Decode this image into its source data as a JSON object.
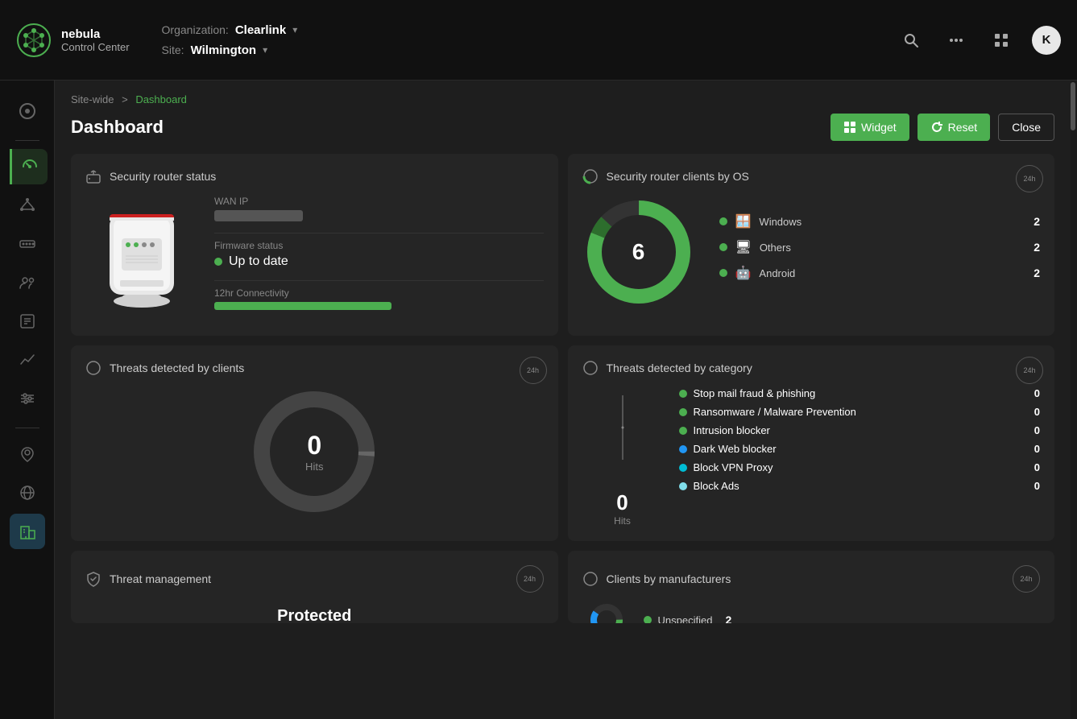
{
  "app": {
    "brand": "nebula",
    "sub": "Control Center"
  },
  "navbar": {
    "organization_label": "Organization:",
    "organization_value": "Clearlink",
    "site_label": "Site:",
    "site_value": "Wilmington",
    "avatar_letter": "K"
  },
  "breadcrumb": {
    "parent": "Site-wide",
    "separator": ">",
    "current": "Dashboard"
  },
  "page": {
    "title": "Dashboard"
  },
  "buttons": {
    "widget": "Widget",
    "reset": "Reset",
    "close": "Close"
  },
  "cards": {
    "security_router": {
      "title": "Security router status",
      "wan_ip_label": "WAN IP",
      "wan_ip_value": "███.███.███.███",
      "firmware_label": "Firmware status",
      "firmware_value": "Up to date",
      "connectivity_label": "12hr Connectivity"
    },
    "clients_by_os": {
      "title": "Security router clients by OS",
      "badge": "24h",
      "total": "6",
      "legend": [
        {
          "label": "Windows",
          "count": "2",
          "color": "#4caf50",
          "icon": "🪟"
        },
        {
          "label": "Others",
          "count": "2",
          "color": "#4caf50",
          "icon": "🖥"
        },
        {
          "label": "Android",
          "count": "2",
          "color": "#4caf50",
          "icon": "🤖"
        }
      ]
    },
    "threats_by_clients": {
      "title": "Threats detected by clients",
      "badge": "24h",
      "hits_num": "0",
      "hits_label": "Hits"
    },
    "threats_by_category": {
      "title": "Threats detected by category",
      "badge": "24h",
      "hits_num": "0",
      "hits_label": "Hits",
      "categories": [
        {
          "label": "Stop mail fraud & phishing",
          "count": "0",
          "color": "#4caf50"
        },
        {
          "label": "Ransomware / Malware Prevention",
          "count": "0",
          "color": "#4caf50"
        },
        {
          "label": "Intrusion blocker",
          "count": "0",
          "color": "#4caf50"
        },
        {
          "label": "Dark Web blocker",
          "count": "0",
          "color": "#2196f3"
        },
        {
          "label": "Block VPN Proxy",
          "count": "0",
          "color": "#00bcd4"
        },
        {
          "label": "Block Ads",
          "count": "0",
          "color": "#80deea"
        }
      ]
    },
    "threat_management": {
      "title": "Threat management",
      "badge": "24h",
      "status": "Protected"
    },
    "clients_by_manufacturers": {
      "title": "Clients by manufacturers",
      "badge": "24h",
      "legend": [
        {
          "label": "Unspecified",
          "count": "2",
          "color": "#4caf50"
        }
      ]
    }
  },
  "sidebar": {
    "items": [
      {
        "icon": "☀",
        "label": "Overview",
        "active": false
      },
      {
        "icon": "📊",
        "label": "Dashboard",
        "active": true
      },
      {
        "icon": "⬡",
        "label": "Network",
        "active": false
      },
      {
        "icon": "▤",
        "label": "Switches",
        "active": false
      },
      {
        "icon": "👥",
        "label": "Clients",
        "active": false
      },
      {
        "icon": "📈",
        "label": "Reports",
        "active": false
      },
      {
        "icon": "📉",
        "label": "Analytics",
        "active": false
      },
      {
        "icon": "⚙",
        "label": "Settings",
        "active": false
      },
      {
        "icon": "📍",
        "label": "Location",
        "active": false
      },
      {
        "icon": "🌐",
        "label": "VPN",
        "active": false
      },
      {
        "icon": "🏢",
        "label": "Buildings",
        "active": false
      }
    ]
  }
}
